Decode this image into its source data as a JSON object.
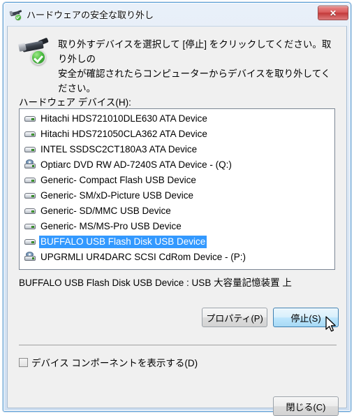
{
  "window": {
    "title": "ハードウェアの安全な取り外し",
    "title_icon": "usb-device-safe-icon",
    "close_glyph": "✕"
  },
  "instruction": {
    "icon": "usb-plug-check-icon",
    "line1": "取り外すデバイスを選択して [停止] をクリックしてください。取り外しの",
    "line2": "安全が確認されたらコンピューターからデバイスを取り外してください。"
  },
  "list": {
    "label": "ハードウェア デバイス(H):",
    "items": [
      {
        "label": "Hitachi HDS721010DLE630 ATA Device",
        "icon": "disk-drive-icon",
        "selected": false
      },
      {
        "label": "Hitachi HDS721050CLA362 ATA Device",
        "icon": "disk-drive-icon",
        "selected": false
      },
      {
        "label": "INTEL SSDSC2CT180A3 ATA Device",
        "icon": "disk-drive-icon",
        "selected": false
      },
      {
        "label": "Optiarc DVD RW AD-7240S ATA Device - (Q:)",
        "icon": "cd-drive-icon",
        "selected": false
      },
      {
        "label": "Generic- Compact Flash USB Device",
        "icon": "disk-drive-icon",
        "selected": false
      },
      {
        "label": "Generic- SM/xD-Picture USB Device",
        "icon": "disk-drive-icon",
        "selected": false
      },
      {
        "label": "Generic- SD/MMC USB Device",
        "icon": "disk-drive-icon",
        "selected": false
      },
      {
        "label": "Generic- MS/MS-Pro USB Device",
        "icon": "disk-drive-icon",
        "selected": false
      },
      {
        "label": "BUFFALO USB Flash Disk USB Device",
        "icon": "disk-drive-icon",
        "selected": true
      },
      {
        "label": "UPGRMLI UR4DARC SCSI CdRom Device - (P:)",
        "icon": "cd-drive-icon",
        "selected": false
      }
    ]
  },
  "status": {
    "text": "BUFFALO USB Flash Disk USB Device : USB 大容量記憶装置 上"
  },
  "buttons": {
    "properties": "プロパティ(P)",
    "stop": "停止(S)",
    "close": "閉じる(C)"
  },
  "checkbox": {
    "label": "デバイス コンポーネントを表示する(D)",
    "checked": false
  },
  "colors": {
    "selection_blue": "#3399ff",
    "frame_blue": "#cddcef",
    "client_gray": "#f0f0f0",
    "close_red": "#c33b3b",
    "hover_blue": "#bee6fd"
  }
}
